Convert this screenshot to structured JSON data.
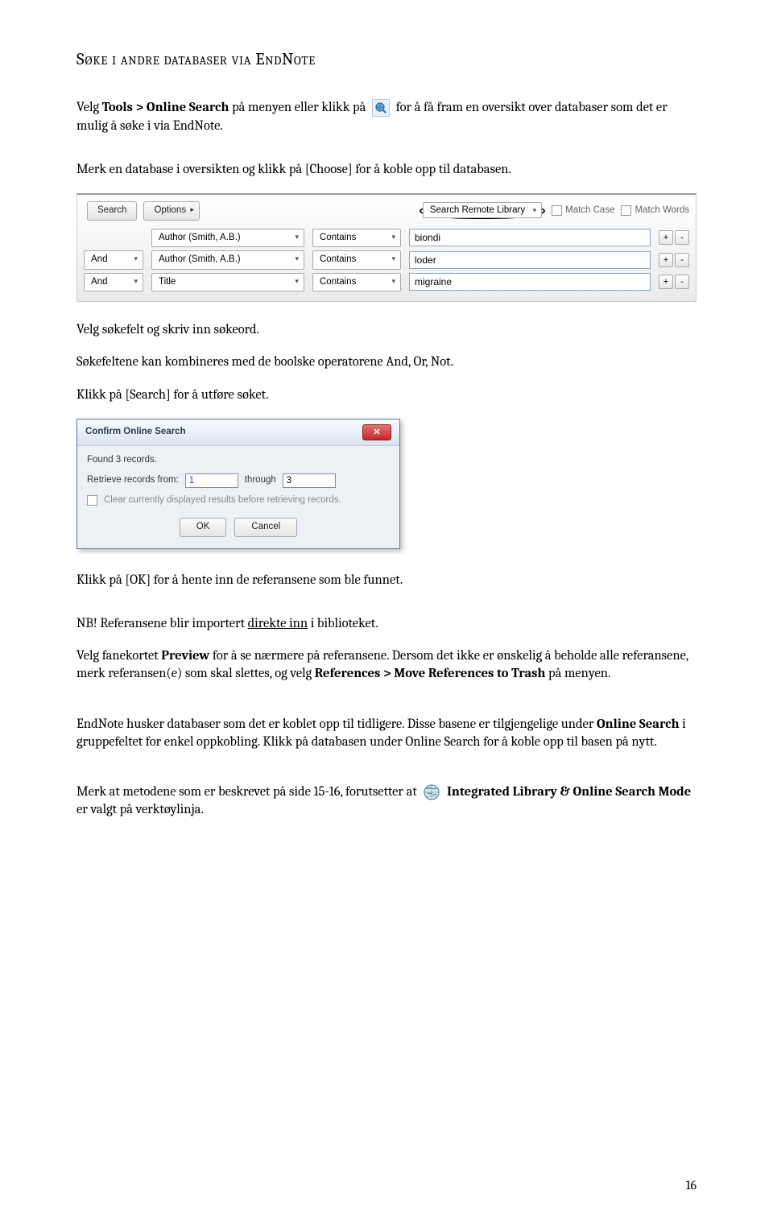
{
  "heading": "Søke i andre databaser via EndNote",
  "para1a": "Velg ",
  "para1b": "Tools > Online Search",
  "para1c": " på menyen eller klikk på ",
  "para1d": " for å få fram en oversikt over databaser som det er mulig å søke i via EndNote.",
  "para2": "Merk en database i oversikten og klikk på [Choose] for å koble opp til databasen.",
  "search_panel": {
    "search_btn": "Search",
    "options_btn": "Options",
    "remote_btn": "Search Remote Library",
    "match_case": "Match Case",
    "match_words": "Match Words",
    "rows": [
      {
        "bool": "",
        "field": "Author (Smith, A.B.)",
        "op": "Contains",
        "val": "biondi"
      },
      {
        "bool": "And",
        "field": "Author (Smith, A.B.)",
        "op": "Contains",
        "val": "loder"
      },
      {
        "bool": "And",
        "field": "Title",
        "op": "Contains",
        "val": "migraine"
      }
    ]
  },
  "para3": "Velg søkefelt og skriv inn søkeord.",
  "para4": "Søkefeltene kan kombineres med de boolske operatorene And, Or, Not.",
  "para5": "Klikk på [Search] for å utføre søket.",
  "dialog": {
    "title": "Confirm Online Search",
    "found": "Found 3 records.",
    "retrieve": "Retrieve records from:",
    "from": "1",
    "through_label": "through",
    "through": "3",
    "clear": "Clear currently displayed results before retrieving records.",
    "ok": "OK",
    "cancel": "Cancel"
  },
  "para6": "Klikk på [OK] for å hente inn de referansene som ble funnet.",
  "para7a": "NB! Referansene blir importert ",
  "para7b": "direkte inn",
  "para7c": " i biblioteket.",
  "para8a": "Velg fanekortet ",
  "para8b": "Preview",
  "para8c": " for å se nærmere på referansene. Dersom det ikke er ønskelig å beholde alle referansene, merk referansen(e) som skal slettes, og velg ",
  "para8d": "References > Move References to Trash",
  "para8e": " på menyen.",
  "para9a": "EndNote husker databaser som det er koblet opp til tidligere. Disse basene er tilgjengelige under ",
  "para9b": "Online Search",
  "para9c": " i gruppefeltet for enkel oppkobling. Klikk på databasen under Online Search for å koble opp til basen på nytt.",
  "para10a": "Merk at metodene som er beskrevet på side 15-16, forutsetter at ",
  "para10b": " Integrated Library & Online Search Mode",
  "para10c": " er valgt på verktøylinja.",
  "pagenum": "16"
}
